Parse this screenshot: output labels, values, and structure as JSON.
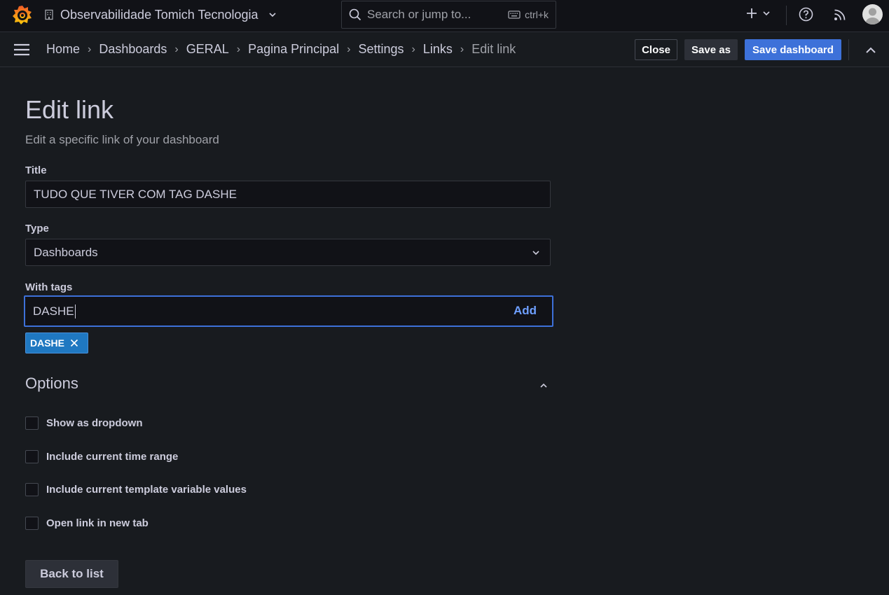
{
  "topbar": {
    "org_name": "Observabilidade Tomich Tecnologia",
    "search_placeholder": "Search or jump to...",
    "search_shortcut": "ctrl+k"
  },
  "breadcrumb": [
    "Home",
    "Dashboards",
    "GERAL",
    "Pagina Principal",
    "Settings",
    "Links",
    "Edit link"
  ],
  "actions": {
    "close_label": "Close",
    "save_as_label": "Save as",
    "save_label": "Save dashboard"
  },
  "page": {
    "title": "Edit link",
    "subtitle": "Edit a specific link of your dashboard"
  },
  "form": {
    "title_label": "Title",
    "title_value": "TUDO QUE TIVER COM TAG DASHE",
    "type_label": "Type",
    "type_value": "Dashboards",
    "tags_label": "With tags",
    "tags_input_value": "DASHE",
    "add_label": "Add",
    "tags": [
      "DASHE"
    ]
  },
  "options": {
    "title": "Options",
    "items": [
      {
        "label": "Show as dropdown",
        "checked": false
      },
      {
        "label": "Include current time range",
        "checked": false
      },
      {
        "label": "Include current template variable values",
        "checked": false
      },
      {
        "label": "Open link in new tab",
        "checked": false
      }
    ]
  },
  "back_label": "Back to list",
  "colors": {
    "primary": "#3d71d9",
    "tag": "#1f78c1",
    "background": "#181b1f",
    "logo": "#f46800"
  },
  "icons": [
    "grafana-logo-icon",
    "building-icon",
    "chevron-down-icon",
    "search-icon",
    "keyboard-icon",
    "plus-icon",
    "help-icon",
    "rss-icon",
    "menu-icon",
    "chevron-up-icon",
    "close-icon"
  ]
}
